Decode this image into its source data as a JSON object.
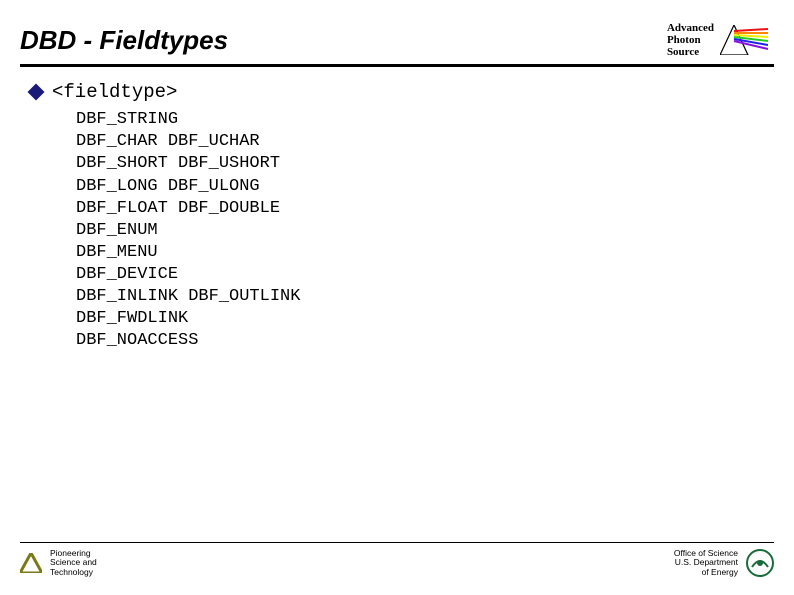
{
  "header": {
    "title": "DBD - Fieldtypes",
    "logo": {
      "line1": "Advanced",
      "line2": "Photon",
      "line3": "Source"
    }
  },
  "bullet": "<fieldtype>",
  "lines": [
    "DBF_STRING",
    "DBF_CHAR DBF_UCHAR",
    "DBF_SHORT DBF_USHORT",
    "DBF_LONG DBF_ULONG",
    "DBF_FLOAT DBF_DOUBLE",
    "DBF_ENUM",
    "DBF_MENU",
    "DBF_DEVICE",
    "DBF_INLINK DBF_OUTLINK",
    "DBF_FWDLINK",
    "DBF_NOACCESS"
  ],
  "footer": {
    "left": {
      "line1": "Pioneering",
      "line2": "Science and",
      "line3": "Technology"
    },
    "right": {
      "line1": "Office of Science",
      "line2": "U.S. Department",
      "line3": "of Energy"
    }
  }
}
